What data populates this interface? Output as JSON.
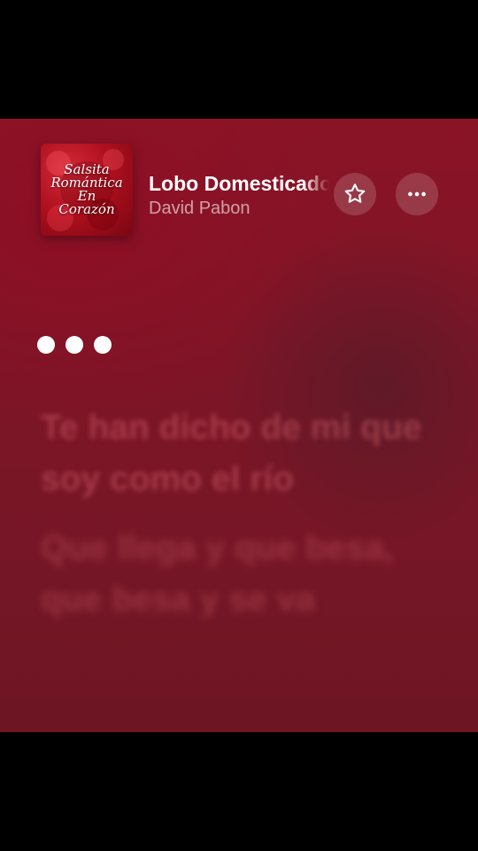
{
  "album": {
    "art_title_lines": [
      "Salsita",
      "Romántica",
      "En",
      "Corazón"
    ],
    "art_colors": {
      "primary": "#b0101e",
      "highlight": "#d42a3a",
      "shadow": "#7a0612"
    }
  },
  "now_playing": {
    "title": "Lobo Domesticado",
    "artist": "David Pabon"
  },
  "controls": {
    "favorite_icon": "star-icon",
    "more_icon": "ellipsis-icon"
  },
  "lyrics": [
    "Te han dicho de mi que soy como el río",
    "Que llega y que besa, que besa y se va"
  ],
  "theme": {
    "background": "#7f1527",
    "accent": "#ffffff",
    "letterbox": "#000000"
  }
}
